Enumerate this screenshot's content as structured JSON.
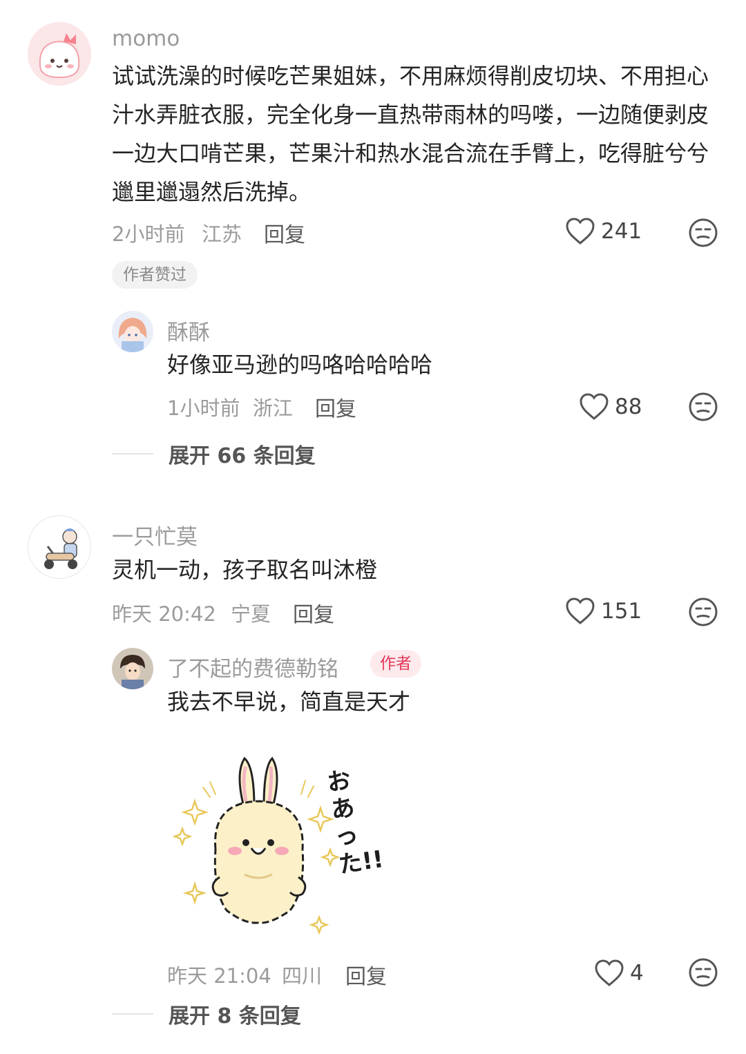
{
  "comments": [
    {
      "username": "momo",
      "content": "试试洗澡的时候吃芒果姐妹，不用麻烦得削皮切块、不用担心汁水弄脏衣服，完全化身一直热带雨林的吗喽，一边随便剥皮一边大口啃芒果，芒果汁和热水混合流在手臂上，吃得脏兮兮邋里邋遢然后洗掉。",
      "time": "2小时前",
      "location": "江苏",
      "reply_label": "回复",
      "likes": "241",
      "badge": "作者赞过",
      "sub_reply": {
        "username": "酥酥",
        "content": "好像亚马逊的吗咯哈哈哈哈",
        "time": "1小时前",
        "location": "浙江",
        "reply_label": "回复",
        "likes": "88"
      },
      "expand_label": "展开 66 条回复"
    },
    {
      "username": "一只忙莫",
      "content": "灵机一动，孩子取名叫沐橙",
      "time": "昨天 20:42",
      "location": "宁夏",
      "reply_label": "回复",
      "likes": "151",
      "sub_reply": {
        "username": "了不起的费德勒铭",
        "author_tag": "作者",
        "content": "我去不早说，简直是天才",
        "sticker_text": "おあった!!",
        "time": "昨天 21:04",
        "location": "四川",
        "reply_label": "回复",
        "likes": "4"
      },
      "expand_label": "展开 8 条回复"
    }
  ],
  "colors": {
    "text_primary": "#242424",
    "text_secondary": "#9b9b9b",
    "author_badge_bg": "#fdeaed",
    "author_badge_text": "#e3395a",
    "liked_badge_bg": "#f2f2f2"
  },
  "icons": [
    "heart-outline-icon",
    "dislike-face-icon"
  ]
}
